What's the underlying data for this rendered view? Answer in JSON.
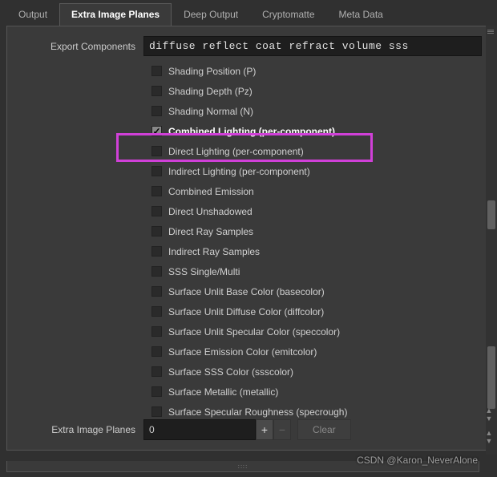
{
  "tabs": [
    {
      "label": "Output"
    },
    {
      "label": "Extra Image Planes"
    },
    {
      "label": "Deep Output"
    },
    {
      "label": "Cryptomatte"
    },
    {
      "label": "Meta Data"
    }
  ],
  "active_tab": 1,
  "export_components": {
    "label": "Export Components",
    "value": "diffuse reflect coat refract volume sss"
  },
  "checkboxes": [
    {
      "label": "Shading Position (P)",
      "checked": false
    },
    {
      "label": "Shading Depth (Pz)",
      "checked": false
    },
    {
      "label": "Shading Normal (N)",
      "checked": false
    },
    {
      "label": "Combined Lighting (per-component)",
      "checked": true,
      "highlighted": true
    },
    {
      "label": "Direct Lighting (per-component)",
      "checked": false
    },
    {
      "label": "Indirect Lighting (per-component)",
      "checked": false
    },
    {
      "label": "Combined Emission",
      "checked": false
    },
    {
      "label": "Direct Unshadowed",
      "checked": false
    },
    {
      "label": "Direct Ray Samples",
      "checked": false
    },
    {
      "label": "Indirect Ray Samples",
      "checked": false
    },
    {
      "label": "SSS Single/Multi",
      "checked": false
    },
    {
      "label": "Surface Unlit Base Color (basecolor)",
      "checked": false
    },
    {
      "label": "Surface Unlit Diffuse Color (diffcolor)",
      "checked": false
    },
    {
      "label": "Surface Unlit Specular Color (speccolor)",
      "checked": false
    },
    {
      "label": "Surface Emission Color (emitcolor)",
      "checked": false
    },
    {
      "label": "Surface SSS Color (ssscolor)",
      "checked": false
    },
    {
      "label": "Surface Metallic (metallic)",
      "checked": false
    },
    {
      "label": "Surface Specular Roughness (specrough)",
      "checked": false
    }
  ],
  "extra_planes": {
    "label": "Extra Image Planes",
    "value": "0",
    "plus": "+",
    "minus": "−",
    "clear": "Clear"
  },
  "watermark": "CSDN @Karon_NeverAlone"
}
